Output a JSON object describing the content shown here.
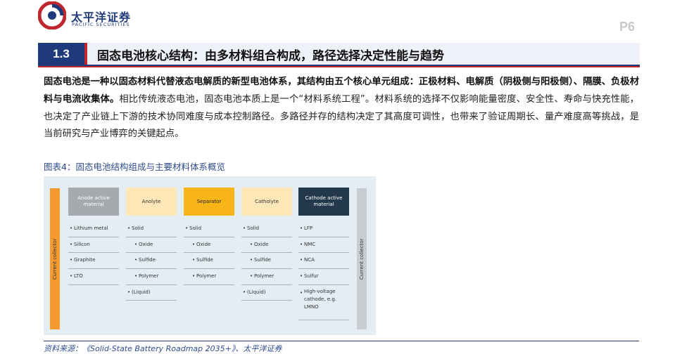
{
  "header": {
    "brand_cn": "太平洋证券",
    "brand_en": "PACIFIC SECURITIES",
    "page_number": "P6"
  },
  "section": {
    "number": "1.3",
    "title": "固态电池核心结构：由多材料组合构成，路径选择决定性能与趋势"
  },
  "paragraph": {
    "bold_lead": "固态电池是一种以固态材料代替液态电解质的新型电池体系，其结构由五个核心单元组成：正极材料、电解质（阴极侧与阳极侧）、隔膜、负极材料与电流收集体。",
    "rest": "相比传统液态电池，固态电池本质上是一个“材料系统工程”。材料系统的选择不仅影响能量密度、安全性、寿命与快充性能，也决定了产业链上下游的技术协同难度与成本控制路径。多路径并存的结构决定了其高度可调性，也带来了验证周期长、量产难度高等挑战，是当前研究与产业博弈的关键起点。"
  },
  "figure": {
    "caption": "图表4：固态电池结构组成与主要材料体系概览",
    "current_collector_left": "Current collector",
    "current_collector_right": "Current collector",
    "columns": [
      {
        "header": "Anode active material",
        "bg": "#a6a9ad",
        "fg": "#ffffff",
        "items": [
          {
            "t": "Lithium metal",
            "sub": false
          },
          {
            "t": "Silicon",
            "sub": false
          },
          {
            "t": "Graphite",
            "sub": false
          },
          {
            "t": "LTO",
            "sub": false
          }
        ]
      },
      {
        "header": "Anolyte",
        "bg": "#fde7b6",
        "fg": "#333333",
        "items": [
          {
            "t": "Solid",
            "sub": false
          },
          {
            "t": "Oxide",
            "sub": true
          },
          {
            "t": "Sulfide",
            "sub": true
          },
          {
            "t": "Polymer",
            "sub": true
          },
          {
            "t": "(Liquid)",
            "sub": false
          }
        ]
      },
      {
        "header": "Separator",
        "bg": "#f8b517",
        "fg": "#222222",
        "items": [
          {
            "t": "Solid",
            "sub": false
          },
          {
            "t": "Oxide",
            "sub": true
          },
          {
            "t": "Sulfide",
            "sub": true
          },
          {
            "t": "Polymer",
            "sub": true
          }
        ]
      },
      {
        "header": "Catholyte",
        "bg": "#fde7b6",
        "fg": "#333333",
        "items": [
          {
            "t": "Solid",
            "sub": false
          },
          {
            "t": "Oxide",
            "sub": true
          },
          {
            "t": "Sulfide",
            "sub": true
          },
          {
            "t": "Polymer",
            "sub": true
          },
          {
            "t": "(Liquid)",
            "sub": false
          }
        ]
      },
      {
        "header": "Cathode active material",
        "bg": "#23384d",
        "fg": "#ffffff",
        "items": [
          {
            "t": "LFP",
            "sub": false
          },
          {
            "t": "NMC",
            "sub": false
          },
          {
            "t": "NCA",
            "sub": false
          },
          {
            "t": "Sulfur",
            "sub": false
          },
          {
            "t": "High-voltage cathode, e.g. LMNO",
            "sub": false,
            "multi": true
          }
        ]
      }
    ]
  },
  "source": "资料来源：《Solid-State Battery Roadmap 2035+》、太平洋证券",
  "colors": {
    "navy": "#1f3a7a",
    "red": "#c0272d",
    "orange": "#f59a2e"
  }
}
